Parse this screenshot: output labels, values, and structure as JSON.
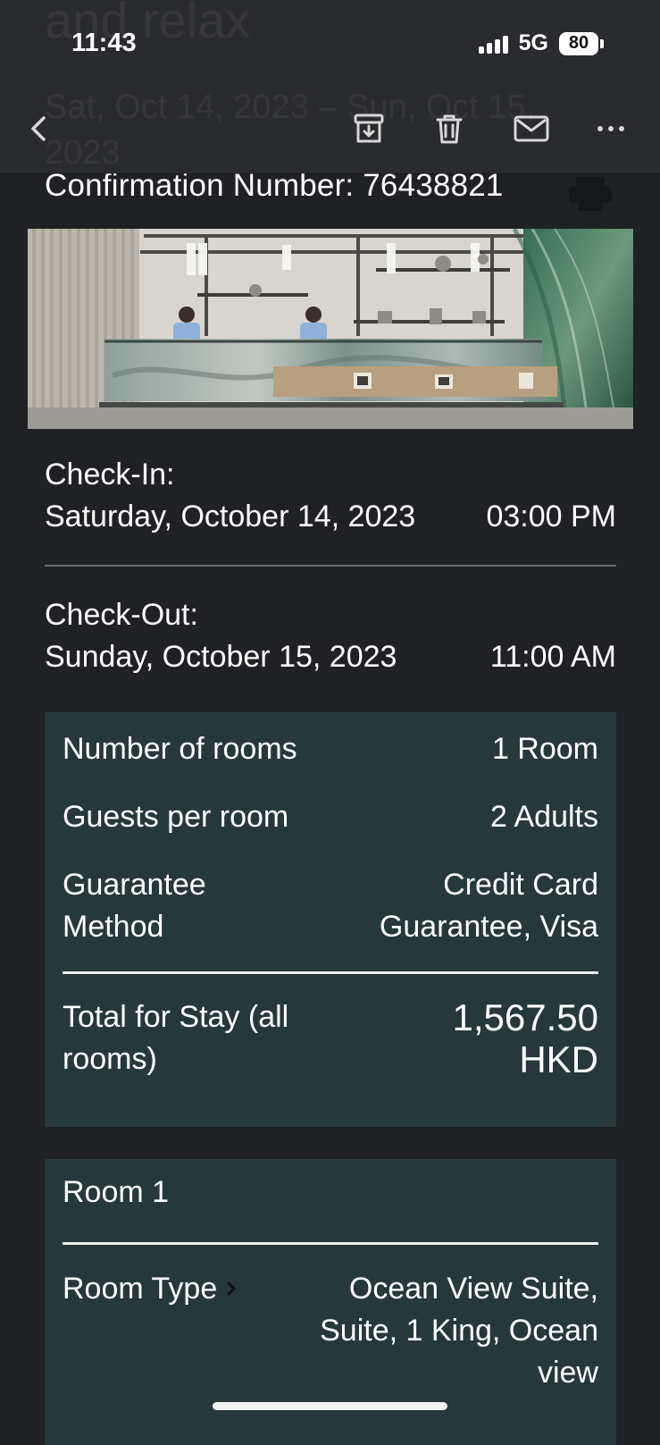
{
  "status_bar": {
    "time": "11:43",
    "network": "5G",
    "battery": "80"
  },
  "toolbar": {
    "back_icon": "chevron-left-icon",
    "archive_icon": "archive-icon",
    "trash_icon": "trash-icon",
    "mail_icon": "mail-icon",
    "more_icon": "more-horizontal-icon"
  },
  "email": {
    "hidden_subject_fragment": "and relax",
    "hidden_date_range": "Sat, Oct 14, 2023 – Sun, Oct 15, 2023",
    "confirmation": "Confirmation Number: 76438821"
  },
  "stay": {
    "checkin_label": "Check-In:",
    "checkin_date": "Saturday, October 14, 2023",
    "checkin_time": "03:00 PM",
    "checkout_label": "Check-Out:",
    "checkout_date": "Sunday, October 15, 2023",
    "checkout_time": "11:00 AM"
  },
  "summary": {
    "rooms_label": "Number of rooms",
    "rooms_value": "1 Room",
    "guests_label": "Guests per room",
    "guests_value": "2 Adults",
    "guarantee_label": "Guarantee\nMethod",
    "guarantee_value": "Credit Card\nGuarantee, Visa",
    "total_label": "Total for Stay (all\nrooms)",
    "total_value": "1,567.50\nHKD"
  },
  "room": {
    "title": "Room 1",
    "type_label": "Room Type",
    "type_value": "Ocean View Suite,\nSuite, 1 King, Ocean\nview"
  },
  "colors": {
    "background": "#1f2124",
    "bar": "#2a2b2e",
    "card": "#27383b",
    "text": "#ffffff",
    "divider": "#686b6f"
  }
}
